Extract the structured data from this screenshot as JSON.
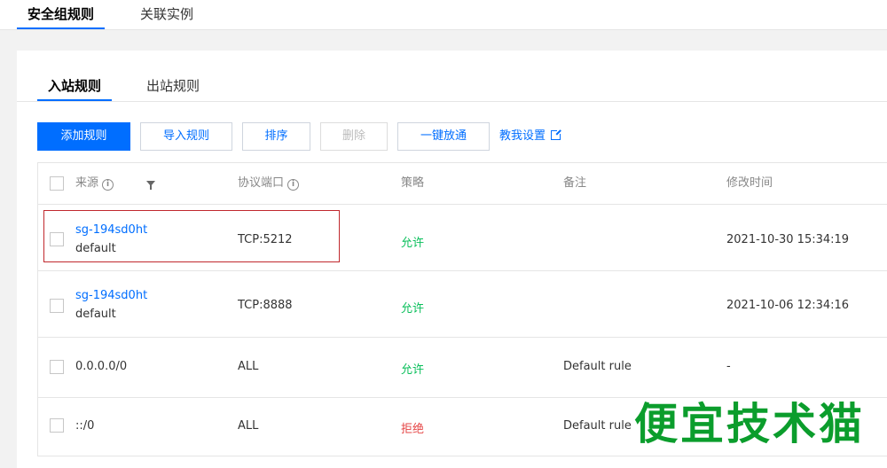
{
  "top_tabs": [
    "安全组规则",
    "关联实例"
  ],
  "sub_tabs": [
    "入站规则",
    "出站规则"
  ],
  "toolbar": {
    "add": "添加规则",
    "import": "导入规则",
    "sort": "排序",
    "delete": "删除",
    "open_all": "一键放通",
    "help": "教我设置"
  },
  "columns": {
    "source": "来源",
    "protocol": "协议端口",
    "policy": "策略",
    "remark": "备注",
    "modified": "修改时间"
  },
  "rows": [
    {
      "source": "sg-194sd0ht",
      "source_sub": "default",
      "protocol": "TCP:5212",
      "policy": "允许",
      "remark": "",
      "modified": "2021-10-30 15:34:19"
    },
    {
      "source": "sg-194sd0ht",
      "source_sub": "default",
      "protocol": "TCP:8888",
      "policy": "允许",
      "remark": "",
      "modified": "2021-10-06 12:34:16"
    },
    {
      "source": "0.0.0.0/0",
      "source_sub": "",
      "protocol": "ALL",
      "policy": "允许",
      "remark": "Default rule",
      "modified": "-"
    },
    {
      "source": "::/0",
      "source_sub": "",
      "protocol": "ALL",
      "policy": "拒绝",
      "remark": "Default rule",
      "modified": "-"
    }
  ],
  "watermark": "便宜技术猫",
  "colors": {
    "accent": "#006eff",
    "allow": "#0abf5b",
    "deny": "#e54545",
    "highlight": "#c0282d"
  }
}
